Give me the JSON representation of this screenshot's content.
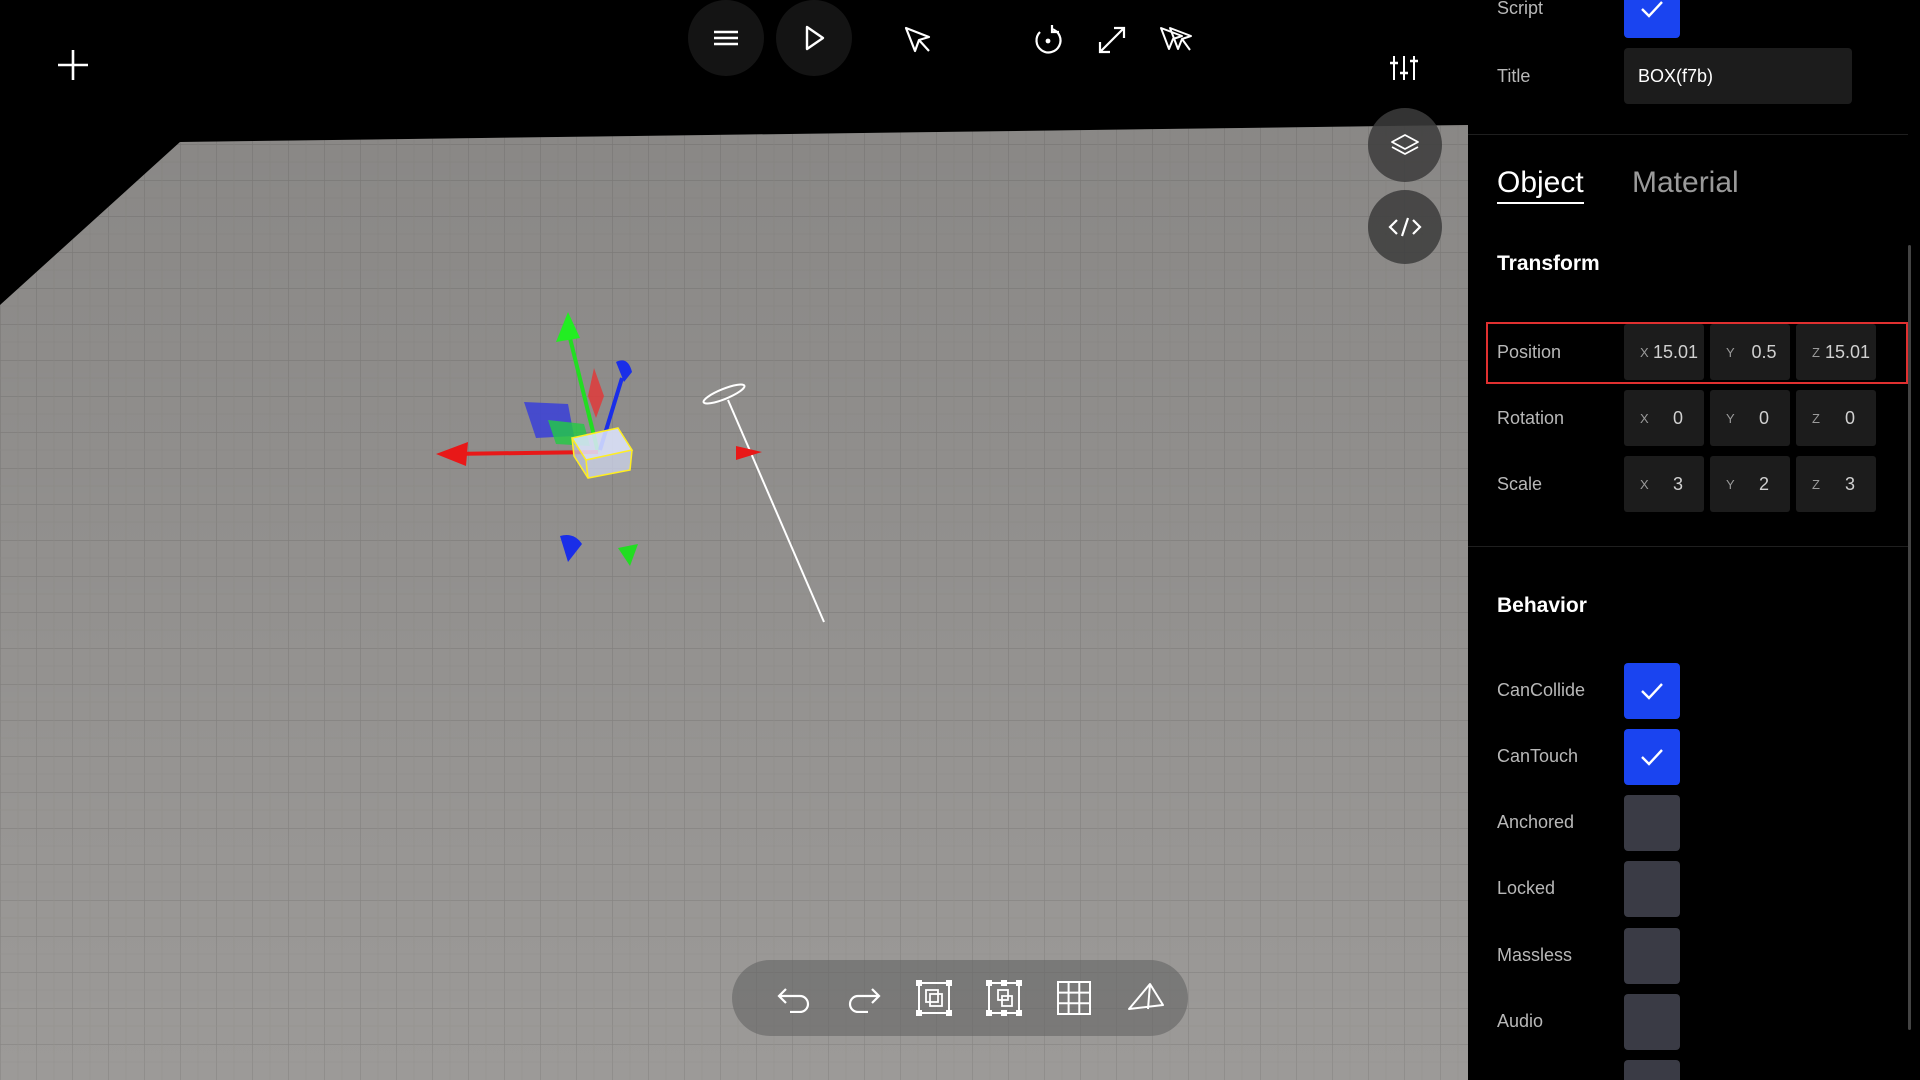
{
  "toolbar": {
    "add_icon": "plus-icon",
    "menu_icon": "hamburger-icon",
    "play_icon": "play-icon",
    "select_icon": "cursor-icon",
    "rotate_icon": "rotate-icon",
    "scale_icon": "expand-icon",
    "multi_select_icon": "multi-cursor-icon",
    "settings_icon": "sliders-icon",
    "layers_icon": "layers-icon",
    "code_icon": "code-icon"
  },
  "bottom_toolbar": {
    "icons": [
      "undo-icon",
      "redo-icon",
      "group-icon",
      "bounding-box-icon",
      "grid-icon",
      "camera-icon"
    ]
  },
  "inspector": {
    "script_label": "Script",
    "script_checked": true,
    "title_label": "Title",
    "title_value": "BOX(f7b)",
    "tabs": [
      {
        "label": "Object",
        "active": true
      },
      {
        "label": "Material",
        "active": false
      }
    ],
    "transform": {
      "heading": "Transform",
      "rows": [
        {
          "label": "Position",
          "x": "15.01",
          "y": "0.5",
          "z": "15.01"
        },
        {
          "label": "Rotation",
          "x": "0",
          "y": "0",
          "z": "0"
        },
        {
          "label": "Scale",
          "x": "3",
          "y": "2",
          "z": "3"
        }
      ],
      "axis_labels": [
        "X",
        "Y",
        "Z"
      ]
    },
    "behavior": {
      "heading": "Behavior",
      "items": [
        {
          "label": "CanCollide",
          "checked": true
        },
        {
          "label": "CanTouch",
          "checked": true
        },
        {
          "label": "Anchored",
          "checked": false
        },
        {
          "label": "Locked",
          "checked": false
        },
        {
          "label": "Massless",
          "checked": false
        },
        {
          "label": "Audio",
          "checked": false
        }
      ]
    }
  },
  "colors": {
    "checkbox_on": "#1a44f0",
    "checkbox_off": "#3a3b45",
    "highlight": "#e03030",
    "floor": "#9a9896"
  }
}
